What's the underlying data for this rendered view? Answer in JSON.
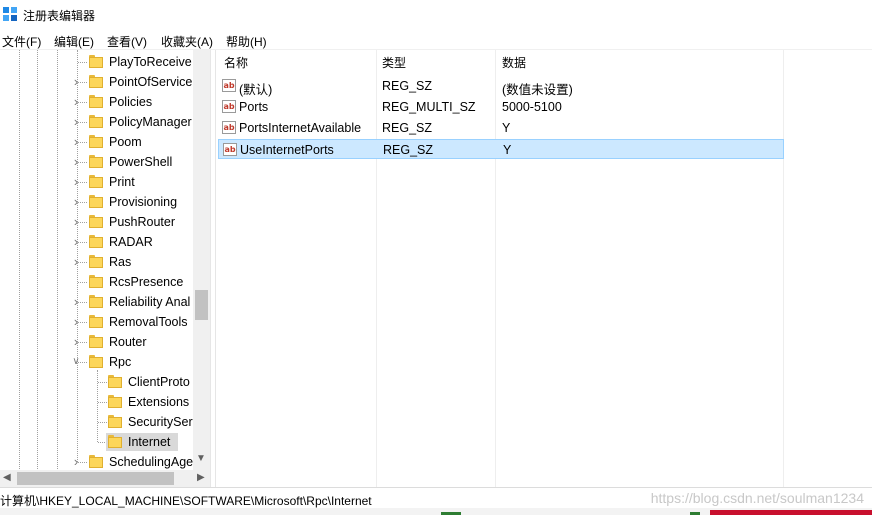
{
  "window": {
    "title": "注册表编辑器"
  },
  "menu": [
    "文件(F)",
    "编辑(E)",
    "查看(V)",
    "收藏夹(A)",
    "帮助(H)"
  ],
  "tree": {
    "items": [
      {
        "label": "PlayToReceive",
        "expander": "none"
      },
      {
        "label": "PointOfService",
        "expander": "collapsed"
      },
      {
        "label": "Policies",
        "expander": "collapsed"
      },
      {
        "label": "PolicyManager",
        "expander": "collapsed"
      },
      {
        "label": "Poom",
        "expander": "collapsed"
      },
      {
        "label": "PowerShell",
        "expander": "collapsed"
      },
      {
        "label": "Print",
        "expander": "collapsed"
      },
      {
        "label": "Provisioning",
        "expander": "collapsed"
      },
      {
        "label": "PushRouter",
        "expander": "collapsed"
      },
      {
        "label": "RADAR",
        "expander": "collapsed"
      },
      {
        "label": "Ras",
        "expander": "collapsed"
      },
      {
        "label": "RcsPresence",
        "expander": "none"
      },
      {
        "label": "Reliability Anal",
        "expander": "collapsed"
      },
      {
        "label": "RemovalTools",
        "expander": "collapsed"
      },
      {
        "label": "Router",
        "expander": "collapsed"
      },
      {
        "label": "Rpc",
        "expander": "expanded"
      },
      {
        "label": "ClientProto",
        "expander": "none",
        "child": true
      },
      {
        "label": "Extensions",
        "expander": "none",
        "child": true
      },
      {
        "label": "SecuritySer",
        "expander": "none",
        "child": true
      },
      {
        "label": "Internet",
        "expander": "none",
        "child": true,
        "selected": true
      },
      {
        "label": "SchedulingAge",
        "expander": "collapsed"
      }
    ]
  },
  "list": {
    "columns": [
      "名称",
      "类型",
      "数据"
    ],
    "rows": [
      {
        "name": "(默认)",
        "type": "REG_SZ",
        "data": "(数值未设置)",
        "icon": "string-value-icon"
      },
      {
        "name": "Ports",
        "type": "REG_MULTI_SZ",
        "data": "5000-5100",
        "icon": "string-value-icon"
      },
      {
        "name": "PortsInternetAvailable",
        "type": "REG_SZ",
        "data": "Y",
        "icon": "string-value-icon"
      },
      {
        "name": "UseInternetPorts",
        "type": "REG_SZ",
        "data": "Y",
        "icon": "string-value-icon",
        "selected": true
      }
    ]
  },
  "statusbar": {
    "path": "计算机\\HKEY_LOCAL_MACHINE\\SOFTWARE\\Microsoft\\Rpc\\Internet",
    "watermark": "https://blog.csdn.net/soulman1234"
  },
  "icons": {
    "string_value_glyph": "ab"
  },
  "colors": {
    "selection": "#cce8ff",
    "folder": "#fcd65a",
    "accent": "#c8102e"
  }
}
